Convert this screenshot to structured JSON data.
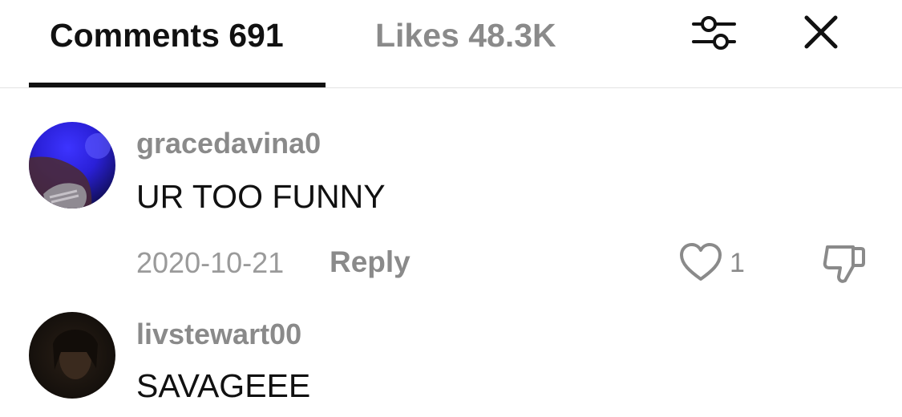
{
  "tabs": [
    {
      "label": "Comments 691",
      "active": true
    },
    {
      "label": "Likes 48.3K",
      "active": false
    }
  ],
  "header": {
    "filter_icon": "sliders-icon",
    "close_icon": "close-icon"
  },
  "colors": {
    "active_text": "#111111",
    "muted_text": "#8a8a8a",
    "divider": "#e3e3e3"
  },
  "comments": [
    {
      "username": "gracedavina0",
      "text": "UR TOO FUNNY",
      "date": "2020-10-21",
      "reply_label": "Reply",
      "like_count": "1"
    },
    {
      "username": "livstewart00",
      "text": "SAVAGEEE"
    }
  ]
}
